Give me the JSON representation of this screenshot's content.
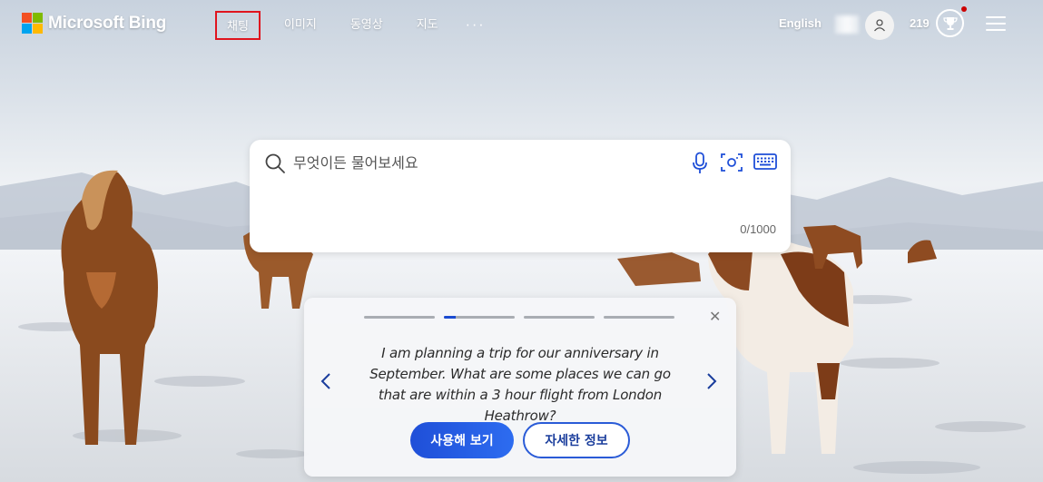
{
  "header": {
    "logo_text": "Microsoft Bing",
    "nav": [
      {
        "label": "채팅",
        "active": true
      },
      {
        "label": "이미지"
      },
      {
        "label": "동영상"
      },
      {
        "label": "지도"
      }
    ],
    "more_label": "···",
    "language": "English",
    "points": "219"
  },
  "search": {
    "placeholder": "무엇이든 물어보세요",
    "value": "",
    "counter": "0/1000"
  },
  "card": {
    "prompt": "I am planning a trip for our anniversary in September. What are some places we can go that are within a 3 hour flight from London Heathrow?",
    "primary_button": "사용해 보기",
    "secondary_button": "자세한 정보",
    "progress_segments": 4,
    "active_segment": 2,
    "close_symbol": "✕"
  },
  "colors": {
    "accent": "#1f4fd8",
    "active_nav_border": "#e0141e",
    "notification_dot": "#cc0000"
  }
}
